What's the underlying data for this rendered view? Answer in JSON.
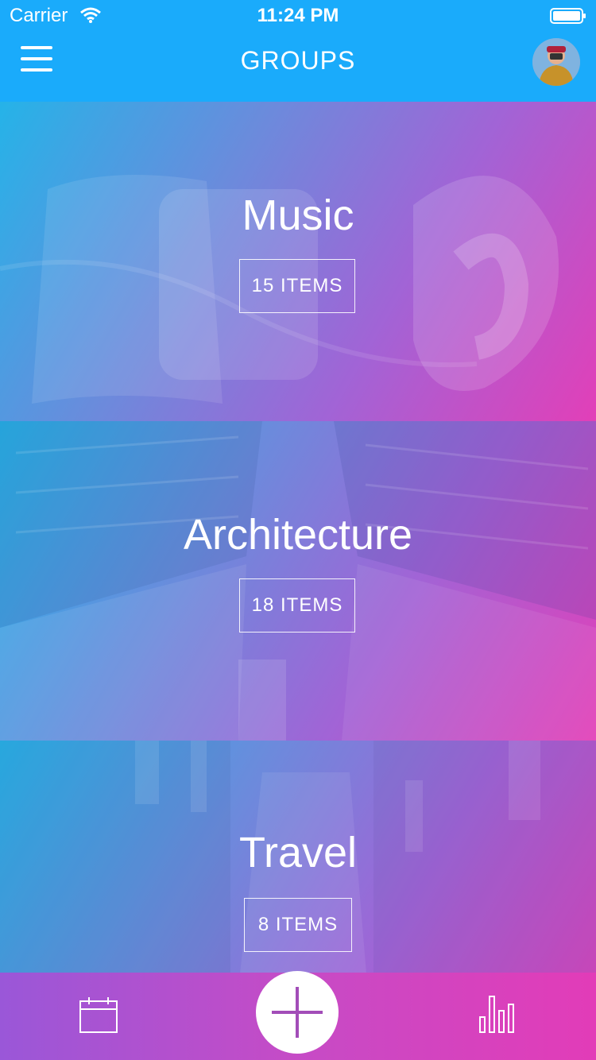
{
  "status_bar": {
    "carrier": "Carrier",
    "time": "11:24 PM"
  },
  "header": {
    "title": "GROUPS"
  },
  "groups": [
    {
      "title": "Music",
      "count_label": "15 ITEMS"
    },
    {
      "title": "Architecture",
      "count_label": "18 ITEMS"
    },
    {
      "title": "Travel",
      "count_label": "8 ITEMS"
    }
  ],
  "tabbar": {
    "icons": [
      "calendar-icon",
      "add-icon",
      "bar-chart-icon"
    ]
  },
  "colors": {
    "header": "#1aabfb",
    "gradient_start": "#25b3e8",
    "gradient_end": "#e23fb8",
    "accent": "#a24db8"
  }
}
